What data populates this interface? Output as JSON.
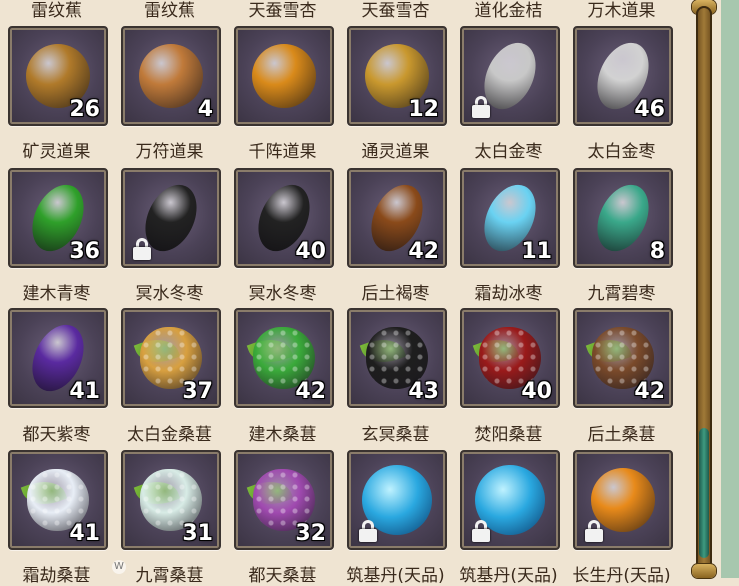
{
  "watermark": "W",
  "rows": [
    {
      "row_label_tops": true,
      "items": [
        {
          "label": "雷纹蕉",
          "count": null,
          "locked": false
        },
        {
          "label": "雷纹蕉",
          "count": null,
          "locked": false
        },
        {
          "label": "天蚕雪杏",
          "count": null,
          "locked": false
        },
        {
          "label": "天蚕雪杏",
          "count": null,
          "locked": false
        },
        {
          "label": "道化金桔",
          "count": null,
          "locked": false
        },
        {
          "label": "万木道果",
          "count": null,
          "locked": false
        }
      ]
    },
    {
      "items": [
        {
          "icon": "pickaxe-fruit-icon",
          "color": "#b07a2a",
          "shape": "round",
          "count": "26",
          "locked": false
        },
        {
          "icon": "talisman-fruit-icon",
          "color": "#c07a3a",
          "shape": "round",
          "count": "4",
          "locked": false
        },
        {
          "icon": "array-fruit-icon",
          "color": "#d98a1a",
          "shape": "round",
          "count": "",
          "locked": false
        },
        {
          "icon": "spirit-fruit-icon",
          "color": "#c9982e",
          "shape": "round",
          "count": "12",
          "locked": false
        },
        {
          "icon": "silver-jujube-icon",
          "color": "#c8c8c8",
          "shape": "oval",
          "count": "",
          "locked": true
        },
        {
          "icon": "silver-jujube-icon",
          "color": "#d2d2d2",
          "shape": "oval",
          "count": "46",
          "locked": false
        }
      ],
      "labels": [
        "矿灵道果",
        "万符道果",
        "千阵道果",
        "通灵道果",
        "太白金枣",
        "太白金枣"
      ]
    },
    {
      "items": [
        {
          "icon": "green-jujube-icon",
          "color": "#2fa02a",
          "shape": "oval",
          "count": "36",
          "locked": false
        },
        {
          "icon": "black-jujube-icon",
          "color": "#222222",
          "shape": "oval",
          "count": "",
          "locked": true
        },
        {
          "icon": "black-jujube-icon",
          "color": "#222222",
          "shape": "oval",
          "count": "40",
          "locked": false
        },
        {
          "icon": "brown-jujube-icon",
          "color": "#8a4a1a",
          "shape": "oval",
          "count": "42",
          "locked": false
        },
        {
          "icon": "ice-jujube-icon",
          "color": "#6ad2f2",
          "shape": "oval",
          "count": "11",
          "locked": false
        },
        {
          "icon": "jade-jujube-icon",
          "color": "#3aa88a",
          "shape": "oval",
          "count": "8",
          "locked": false
        }
      ],
      "labels": [
        "建木青枣",
        "冥水冬枣",
        "冥水冬枣",
        "后土褐枣",
        "霜劫冰枣",
        "九霄碧枣"
      ]
    },
    {
      "items": [
        {
          "icon": "purple-jujube-icon",
          "color": "#5a2aa0",
          "shape": "oval",
          "count": "41",
          "locked": false
        },
        {
          "icon": "gold-mulberry-icon",
          "color": "#d8a040",
          "shape": "berry",
          "count": "37",
          "locked": false
        },
        {
          "icon": "green-mulberry-icon",
          "color": "#3aaa3a",
          "shape": "berry",
          "count": "42",
          "locked": false
        },
        {
          "icon": "black-mulberry-icon",
          "color": "#1e1e1e",
          "shape": "berry",
          "count": "43",
          "locked": false
        },
        {
          "icon": "red-mulberry-icon",
          "color": "#9a1a1a",
          "shape": "berry",
          "count": "40",
          "locked": false
        },
        {
          "icon": "brown-mulberry-icon",
          "color": "#7a4a2a",
          "shape": "berry",
          "count": "42",
          "locked": false
        }
      ],
      "labels": [
        "都天紫枣",
        "太白金桑葚",
        "建木桑葚",
        "玄冥桑葚",
        "焚阳桑葚",
        "后土桑葚"
      ]
    },
    {
      "items": [
        {
          "icon": "white-mulberry-icon",
          "color": "#e8eef6",
          "shape": "berry",
          "count": "41",
          "locked": false
        },
        {
          "icon": "frost-mulberry-icon",
          "color": "#d8ece6",
          "shape": "berry",
          "count": "31",
          "locked": false
        },
        {
          "icon": "purple-mulberry-icon",
          "color": "#a04ab0",
          "shape": "berry",
          "count": "32",
          "locked": false
        },
        {
          "icon": "meditation-pill-icon",
          "color": "#2aa8e0",
          "shape": "orb",
          "count": "",
          "locked": true
        },
        {
          "icon": "meditation-pill-icon",
          "color": "#2aa8e0",
          "shape": "orb",
          "count": "",
          "locked": true
        },
        {
          "icon": "longevity-pill-icon",
          "color": "#e88a1a",
          "shape": "round",
          "count": "",
          "locked": true
        }
      ],
      "labels": [
        "霜劫桑葚",
        "九霄桑葚",
        "都天桑葚",
        "筑基丹(天品)",
        "筑基丹(天品)",
        "长生丹(天品)"
      ]
    }
  ]
}
